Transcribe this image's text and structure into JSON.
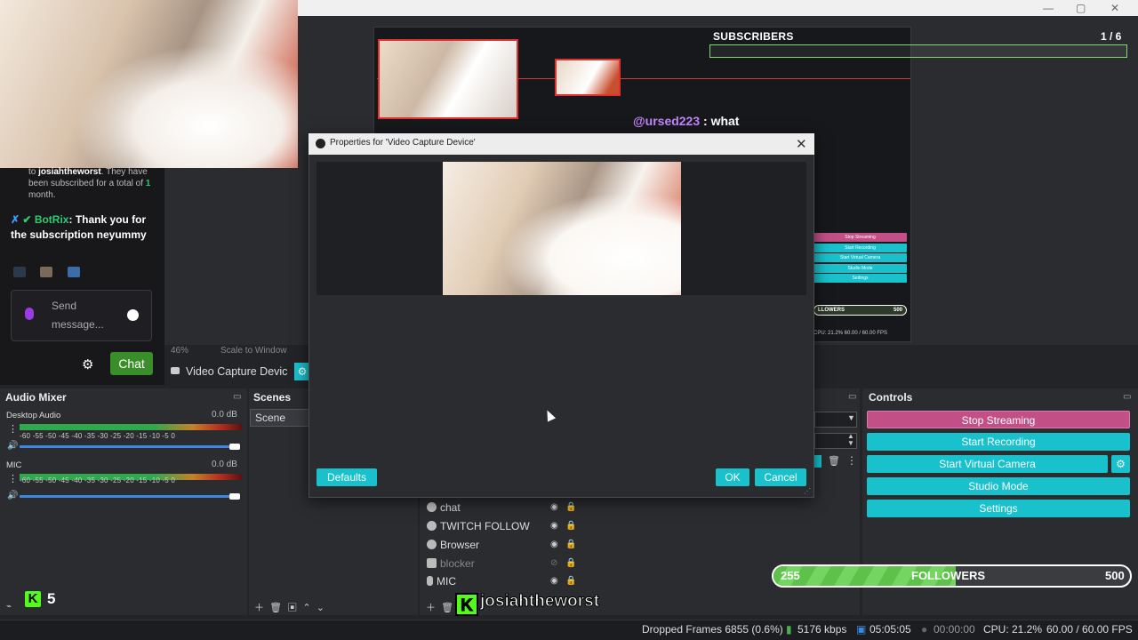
{
  "window": {
    "minimize": "—",
    "maximize": "▢",
    "close": "✕"
  },
  "preview": {
    "subs_label": "SUBSCRIBERS",
    "subs_count": "1 / 6",
    "chat_user": "@ursed223",
    "chat_msg": " : what",
    "mini_controls": [
      "Stop Streaming",
      "Start Recording",
      "Start Virtual Camera",
      "Studio Mode",
      "Settings"
    ],
    "mini_followers": "LLOWERS",
    "mini_followers_max": "500",
    "mini_stats": "CPU: 21.2%   60.00 / 60.00 FPS",
    "zoom_label": "46%",
    "scale_label": "Scale to Window"
  },
  "source_toolbar": {
    "name": "Video Capture Devic",
    "gear": "⚙"
  },
  "chat": {
    "sub_prefix": "to",
    "sub_user": "josiahtheworst",
    "sub_text_1": ". They have been subscribed for a total of",
    "sub_months": "1",
    "sub_text_2": "month.",
    "bot_name": "BotRix",
    "bot_msg": ": Thank you for the subscription neyummy",
    "send_placeholder": "Send message...",
    "chat_button": "Chat"
  },
  "audio_mixer": {
    "title": "Audio Mixer",
    "scale": "-60 -55 -50 -45 -40 -35 -30 -25 -20 -15 -10 -5 0",
    "channels": [
      {
        "name": "Desktop Audio",
        "db": "0.0 dB"
      },
      {
        "name": "MIC",
        "db": "0.0 dB"
      }
    ]
  },
  "scenes": {
    "title": "Scenes",
    "items": [
      "Scene"
    ]
  },
  "sources": {
    "items": [
      "chat",
      "TWITCH FOLLOW",
      "Browser",
      "blocker",
      "MIC"
    ]
  },
  "controls": {
    "title": "Controls",
    "stop_streaming": "Stop Streaming",
    "start_recording": "Start Recording",
    "start_virtual_camera": "Start Virtual Camera",
    "studio_mode": "Studio Mode",
    "settings": "Settings"
  },
  "followers": {
    "current": "255",
    "label": "FOLLOWERS",
    "goal": "500",
    "progress": 0.51
  },
  "kick": {
    "logo": "K",
    "count": "5"
  },
  "name_tag": {
    "logo": "K",
    "name": "josiahtheworst"
  },
  "status": {
    "dropped": "Dropped Frames 6855 (0.6%)",
    "bitrate": "5176 kbps",
    "stream_time": "05:05:05",
    "rec_time": "00:00:00",
    "cpu": "CPU: 21.2%",
    "fps": "60.00 / 60.00 FPS"
  },
  "dialog": {
    "title": "Properties for 'Video Capture Device'",
    "defaults": "Defaults",
    "ok": "OK",
    "cancel": "Cancel"
  },
  "colors": {
    "accent": "#18c1cc",
    "stop": "#c24f86",
    "kick": "#53fc18"
  }
}
